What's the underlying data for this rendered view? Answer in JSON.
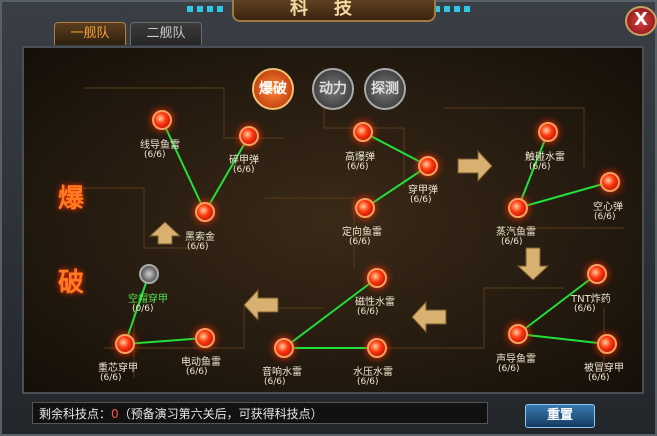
{
  "window": {
    "title": "科技",
    "close_symbol": "X"
  },
  "tabs": [
    {
      "label": "一舰队",
      "active": true
    },
    {
      "label": "二舰队",
      "active": false
    }
  ],
  "categories": [
    {
      "label": "爆破",
      "active": true
    },
    {
      "label": "动力",
      "active": false
    },
    {
      "label": "探测",
      "active": false
    }
  ],
  "side_label": {
    "line1": "爆",
    "line2": "破"
  },
  "nodes": [
    {
      "id": "xdyl",
      "name": "线导鱼雷",
      "progress": "(6/6)",
      "locked": false
    },
    {
      "id": "sjd",
      "name": "碎甲弹",
      "progress": "(6/6)",
      "locked": false
    },
    {
      "id": "hsj",
      "name": "黑索金",
      "progress": "(6/6)",
      "locked": false
    },
    {
      "id": "gbd",
      "name": "高爆弹",
      "progress": "(6/6)",
      "locked": false
    },
    {
      "id": "cjd",
      "name": "穿甲弹",
      "progress": "(6/6)",
      "locked": false
    },
    {
      "id": "dxyl",
      "name": "定向鱼雷",
      "progress": "(6/6)",
      "locked": false
    },
    {
      "id": "cpsl",
      "name": "触碰水雷",
      "progress": "(6/6)",
      "locked": false
    },
    {
      "id": "kxd",
      "name": "空心弹",
      "progress": "(6/6)",
      "locked": false
    },
    {
      "id": "zqyl",
      "name": "蒸汽鱼雷",
      "progress": "(6/6)",
      "locked": false
    },
    {
      "id": "tnt",
      "name": "TNT炸药",
      "progress": "(6/6)",
      "locked": false
    },
    {
      "id": "syyl",
      "name": "声导鱼雷",
      "progress": "(6/6)",
      "locked": false
    },
    {
      "id": "bmcj",
      "name": "被冒穿甲",
      "progress": "(6/6)",
      "locked": false
    },
    {
      "id": "kdcj",
      "name": "空帽穿甲",
      "progress": "(0/6)",
      "locked": true
    },
    {
      "id": "zxcj",
      "name": "重芯穿甲",
      "progress": "(6/6)",
      "locked": false
    },
    {
      "id": "ddyl",
      "name": "电动鱼雷",
      "progress": "(6/6)",
      "locked": false
    },
    {
      "id": "cxsl",
      "name": "磁性水雷",
      "progress": "(6/6)",
      "locked": false
    },
    {
      "id": "sxsl",
      "name": "音响水雷",
      "progress": "(6/6)",
      "locked": false
    },
    {
      "id": "sysl",
      "name": "水压水雷",
      "progress": "(6/6)",
      "locked": false
    }
  ],
  "footer": {
    "points_label": "剩余科技点：",
    "points_value": "0",
    "hint": "（预备演习第六关后，可获得科技点）",
    "reset_label": "重置"
  },
  "colors": {
    "accent": "#ff7a20",
    "link": "#22e03a",
    "locked_text": "#4fe24f"
  }
}
